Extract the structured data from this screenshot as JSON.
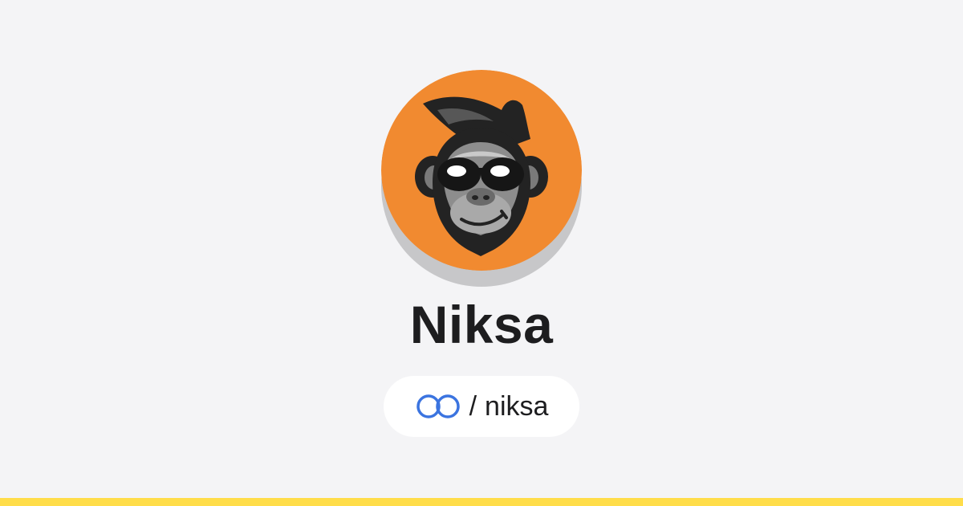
{
  "profile": {
    "display_name": "Niksa",
    "handle_separator": "/",
    "handle": "niksa",
    "avatar_icon": "monkey-sunglasses-icon",
    "link_icon": "linked-rings-icon"
  },
  "colors": {
    "background": "#f4f4f6",
    "avatar_background": "#f18a30",
    "link_icon": "#3b74e0",
    "accent_bar": "#ffdd4a",
    "text": "#1d1d1f"
  }
}
